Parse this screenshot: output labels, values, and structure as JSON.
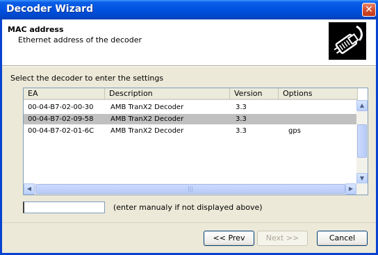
{
  "window": {
    "title": "Decoder Wizard",
    "close_glyph": "✕"
  },
  "header": {
    "title": "MAC address",
    "subtitle": "Ethernet address of the decoder",
    "logo_icon": "ethernet-plug-icon"
  },
  "prompt": "Select the decoder to enter the settings",
  "list": {
    "columns": [
      "EA",
      "Description",
      "Version",
      "Options"
    ],
    "rows": [
      {
        "ea": "00-04-B7-02-00-30",
        "description": "AMB TranX2 Decoder",
        "version": "3.3",
        "options": "",
        "selected": false
      },
      {
        "ea": "00-04-B7-02-09-58",
        "description": "AMB TranX2 Decoder",
        "version": "3.3",
        "options": "",
        "selected": true
      },
      {
        "ea": "00-04-B7-02-01-6C",
        "description": "AMB TranX2 Decoder",
        "version": "3.3",
        "options": "gps",
        "selected": false
      }
    ],
    "scroll_icons": {
      "up": "▲",
      "down": "▼",
      "left": "◀",
      "right": "▶",
      "grip": "|||"
    }
  },
  "manual": {
    "value": "",
    "hint": "(enter manualy if not displayed above)"
  },
  "buttons": {
    "prev": "<< Prev",
    "next": "Next >>",
    "cancel": "Cancel"
  },
  "colors": {
    "title_bar": "#0052e0",
    "selected_row": "#c0c0c0",
    "close": "#d34a2a"
  }
}
